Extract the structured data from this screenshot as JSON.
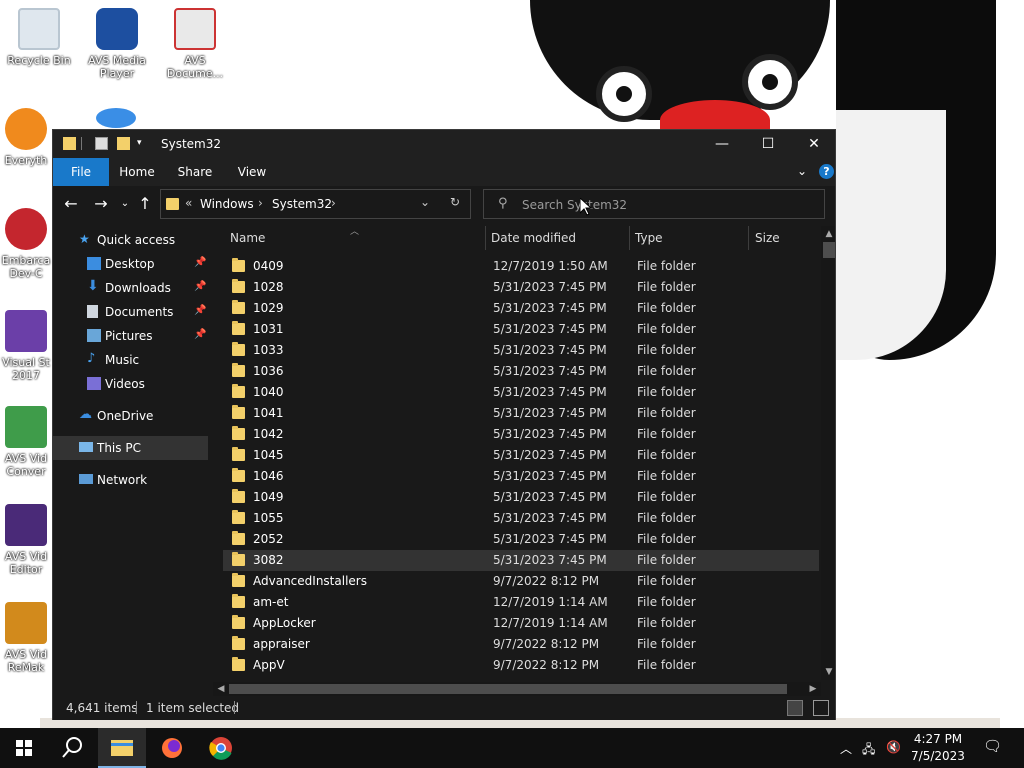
{
  "desktop": {
    "icons": [
      {
        "label": "Recycle Bin"
      },
      {
        "label": "AVS Media Player"
      },
      {
        "label": "AVS Docume..."
      },
      {
        "label": "Everyth"
      },
      {
        "label": "Embarca Dev-C"
      },
      {
        "label": "Visual St 2017"
      },
      {
        "label": "AVS Vid Conver"
      },
      {
        "label": "AVS Vid Editor"
      },
      {
        "label": "AVS Vid ReMak"
      }
    ]
  },
  "window": {
    "title": "System32",
    "controls": {
      "minimize": "—",
      "maximize": "☐",
      "close": "✕"
    }
  },
  "ribbon": {
    "tabs": [
      "File",
      "Home",
      "Share",
      "View"
    ]
  },
  "address": {
    "overflow": "«",
    "segments": [
      "Windows",
      "System32"
    ],
    "separator": "›"
  },
  "search": {
    "placeholder": "Search System32"
  },
  "navpane": {
    "items": [
      {
        "label": "Quick access",
        "icon": "star-icon"
      },
      {
        "label": "Desktop",
        "icon": "desktop-icon"
      },
      {
        "label": "Downloads",
        "icon": "download-icon"
      },
      {
        "label": "Documents",
        "icon": "documents-icon"
      },
      {
        "label": "Pictures",
        "icon": "pictures-icon"
      },
      {
        "label": "Music",
        "icon": "music-icon"
      },
      {
        "label": "Videos",
        "icon": "videos-icon"
      },
      {
        "label": "OneDrive",
        "icon": "cloud-icon"
      },
      {
        "label": "This PC",
        "icon": "computer-icon"
      },
      {
        "label": "Network",
        "icon": "network-icon"
      }
    ]
  },
  "columns": {
    "name": "Name",
    "date": "Date modified",
    "type": "Type",
    "size": "Size"
  },
  "files": [
    {
      "name": "0409",
      "date": "12/7/2019 1:50 AM",
      "type": "File folder"
    },
    {
      "name": "1028",
      "date": "5/31/2023 7:45 PM",
      "type": "File folder"
    },
    {
      "name": "1029",
      "date": "5/31/2023 7:45 PM",
      "type": "File folder"
    },
    {
      "name": "1031",
      "date": "5/31/2023 7:45 PM",
      "type": "File folder"
    },
    {
      "name": "1033",
      "date": "5/31/2023 7:45 PM",
      "type": "File folder"
    },
    {
      "name": "1036",
      "date": "5/31/2023 7:45 PM",
      "type": "File folder"
    },
    {
      "name": "1040",
      "date": "5/31/2023 7:45 PM",
      "type": "File folder"
    },
    {
      "name": "1041",
      "date": "5/31/2023 7:45 PM",
      "type": "File folder"
    },
    {
      "name": "1042",
      "date": "5/31/2023 7:45 PM",
      "type": "File folder"
    },
    {
      "name": "1045",
      "date": "5/31/2023 7:45 PM",
      "type": "File folder"
    },
    {
      "name": "1046",
      "date": "5/31/2023 7:45 PM",
      "type": "File folder"
    },
    {
      "name": "1049",
      "date": "5/31/2023 7:45 PM",
      "type": "File folder"
    },
    {
      "name": "1055",
      "date": "5/31/2023 7:45 PM",
      "type": "File folder"
    },
    {
      "name": "2052",
      "date": "5/31/2023 7:45 PM",
      "type": "File folder"
    },
    {
      "name": "3082",
      "date": "5/31/2023 7:45 PM",
      "type": "File folder"
    },
    {
      "name": "AdvancedInstallers",
      "date": "9/7/2022 8:12 PM",
      "type": "File folder"
    },
    {
      "name": "am-et",
      "date": "12/7/2019 1:14 AM",
      "type": "File folder"
    },
    {
      "name": "AppLocker",
      "date": "12/7/2019 1:14 AM",
      "type": "File folder"
    },
    {
      "name": "appraiser",
      "date": "9/7/2022 8:12 PM",
      "type": "File folder"
    },
    {
      "name": "AppV",
      "date": "9/7/2022 8:12 PM",
      "type": "File folder"
    }
  ],
  "status": {
    "count": "4,641 items",
    "selected": "1 item selected"
  },
  "taskbar": {
    "time": "4:27 PM",
    "date": "7/5/2023"
  },
  "colors": {
    "accent": "#1979ca",
    "folder": "#f3d06a",
    "background": "#191919"
  }
}
